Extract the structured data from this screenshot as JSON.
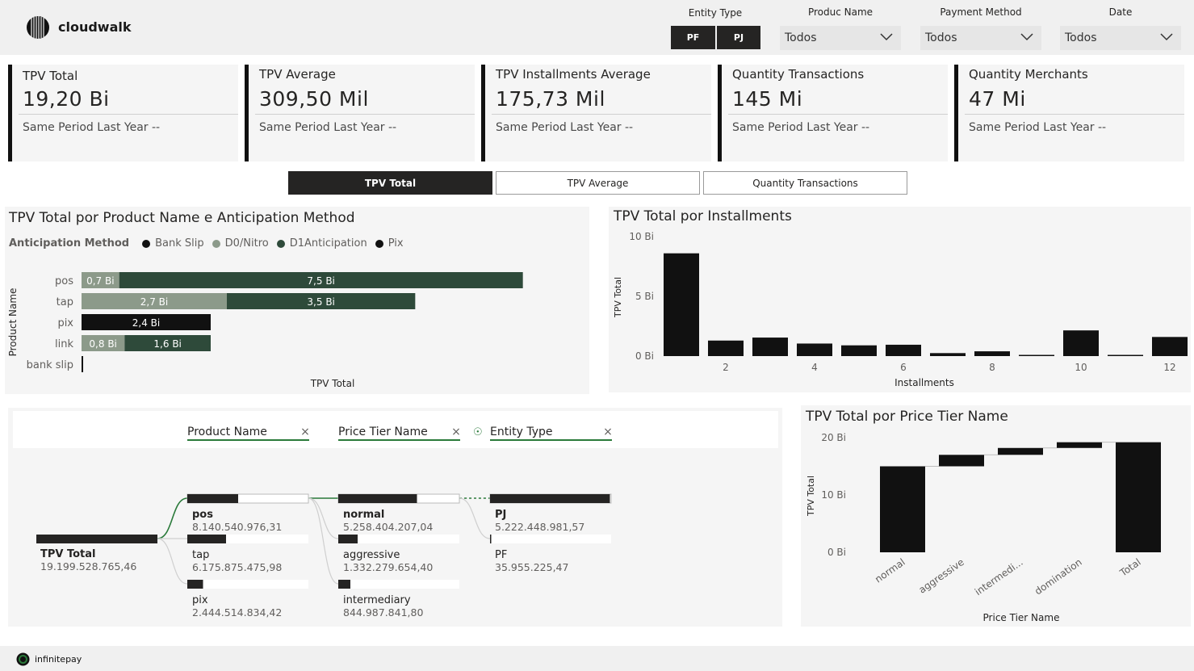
{
  "brand": {
    "logo_text": "cloudwalk",
    "footer_text": "infinitepay"
  },
  "filters": {
    "entity_type": {
      "label": "Entity Type",
      "options": [
        "PF",
        "PJ"
      ]
    },
    "product_name": {
      "label": "Produc Name",
      "value": "Todos"
    },
    "payment_method": {
      "label": "Payment Method",
      "value": "Todos"
    },
    "date": {
      "label": "Date",
      "value": "Todos"
    }
  },
  "kpis": [
    {
      "title": "TPV Total",
      "value": "19,20 Bi",
      "sub": "Same Period Last Year --"
    },
    {
      "title": "TPV Average",
      "value": "309,50 Mil",
      "sub": "Same Period Last Year --"
    },
    {
      "title": "TPV Installments Average",
      "value": "175,73 Mil",
      "sub": "Same Period Last Year --"
    },
    {
      "title": "Quantity Transactions",
      "value": "145 Mi",
      "sub": "Same Period Last Year --"
    },
    {
      "title": "Quantity Merchants",
      "value": "47 Mi",
      "sub": "Same Period Last Year --"
    }
  ],
  "tabs": [
    "TPV Total",
    "TPV Average",
    "Quantity Transactions"
  ],
  "colors": {
    "dark": "#111111",
    "green": "#2e4a3a",
    "sage": "#8c9a8a",
    "accent": "#2a7a3a"
  },
  "chart1": {
    "title": "TPV Total por Product Name e Anticipation Method",
    "legend_title": "Anticipation Method",
    "ylabel": "Product Name",
    "xlabel": "TPV Total"
  },
  "chart2": {
    "title": "TPV Total por Installments",
    "ylabel": "TPV Total",
    "xlabel": "Installments",
    "yticks": [
      "10 Bi",
      "5 Bi",
      "0 Bi"
    ]
  },
  "chart3": {
    "title": "TPV Total por Price Tier Name",
    "ylabel": "TPV Total",
    "xlabel": "Price Tier Name",
    "yticks": [
      "20 Bi",
      "10 Bi",
      "0 Bi"
    ]
  },
  "chart_data": [
    {
      "type": "bar",
      "orientation": "horizontal",
      "stacked": true,
      "title": "TPV Total por Product Name e Anticipation Method",
      "xlabel": "TPV Total",
      "ylabel": "Product Name",
      "categories": [
        "pos",
        "tap",
        "pix",
        "link",
        "bank slip"
      ],
      "series": [
        {
          "name": "D0/Nitro",
          "color": "#8c9a8a",
          "values": [
            0.7,
            2.7,
            0,
            0.8,
            0
          ],
          "labels": [
            "0,7 Bi",
            "2,7 Bi",
            "",
            "0,8 Bi",
            ""
          ]
        },
        {
          "name": "D1Anticipation",
          "color": "#2e4a3a",
          "values": [
            7.5,
            3.5,
            0,
            1.6,
            0
          ],
          "labels": [
            "7,5 Bi",
            "3,5 Bi",
            "",
            "1,6 Bi",
            ""
          ]
        },
        {
          "name": "Pix",
          "color": "#111111",
          "values": [
            0,
            0,
            2.4,
            0,
            0
          ],
          "labels": [
            "",
            "",
            "2,4 Bi",
            "",
            ""
          ]
        },
        {
          "name": "Bank Slip",
          "color": "#111111",
          "values": [
            0,
            0,
            0,
            0,
            0.03
          ],
          "labels": [
            "",
            "",
            "",
            "",
            ""
          ]
        }
      ],
      "xlim": [
        0,
        9.0
      ],
      "legend": "top-left"
    },
    {
      "type": "bar",
      "title": "TPV Total por Installments",
      "xlabel": "Installments",
      "ylabel": "TPV Total",
      "categories": [
        1,
        2,
        3,
        4,
        5,
        6,
        7,
        8,
        9,
        10,
        11,
        12
      ],
      "xticks": [
        2,
        4,
        6,
        8,
        10,
        12
      ],
      "values": [
        8.6,
        1.3,
        1.55,
        1.05,
        0.9,
        0.95,
        0.25,
        0.4,
        0.1,
        2.15,
        0.05,
        1.6
      ],
      "ylim": [
        0,
        10
      ]
    },
    {
      "type": "bar",
      "subtype": "waterfall",
      "title": "TPV Total por Price Tier Name",
      "xlabel": "Price Tier Name",
      "ylabel": "TPV Total",
      "categories": [
        "normal",
        "aggressive",
        "intermedi...",
        "domination",
        "Total"
      ],
      "values": [
        15.0,
        2.0,
        1.2,
        1.0,
        19.2
      ],
      "ylim": [
        0,
        20
      ]
    }
  ],
  "decomp": {
    "fields": [
      "Product Name",
      "Price Tier Name",
      "Entity Type"
    ],
    "root": {
      "label": "TPV Total",
      "value": "19.199.528.765,46"
    },
    "level1": [
      {
        "label": "pos",
        "value": "8.140.540.976,31",
        "frac": 0.42
      },
      {
        "label": "tap",
        "value": "6.175.875.475,98",
        "frac": 0.32
      },
      {
        "label": "pix",
        "value": "2.444.514.834,42",
        "frac": 0.13
      }
    ],
    "level2": [
      {
        "label": "normal",
        "value": "5.258.404.207,04",
        "frac": 0.65
      },
      {
        "label": "aggressive",
        "value": "1.332.279.654,40",
        "frac": 0.16
      },
      {
        "label": "intermediary",
        "value": "844.987.841,80",
        "frac": 0.1
      }
    ],
    "level3": [
      {
        "label": "PJ",
        "value": "5.222.448.981,57",
        "frac": 0.99
      },
      {
        "label": "PF",
        "value": "35.955.225,47",
        "frac": 0.007
      }
    ]
  }
}
